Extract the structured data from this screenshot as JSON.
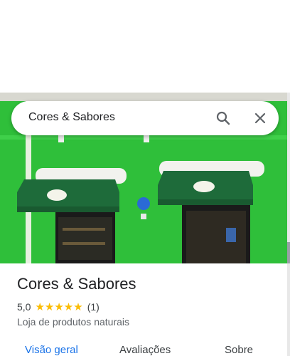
{
  "search": {
    "query": "Cores & Sabores",
    "search_icon": "search-icon",
    "close_icon": "close-icon"
  },
  "place": {
    "name": "Cores & Sabores",
    "rating": "5,0",
    "stars": "★★★★★",
    "review_count": "(1)",
    "category": "Loja de produtos naturais"
  },
  "tabs": [
    {
      "label": "Visão geral",
      "active": true
    },
    {
      "label": "Avaliações",
      "active": false
    },
    {
      "label": "Sobre",
      "active": false
    }
  ],
  "colors": {
    "accent": "#1a73e8",
    "star": "#fbbc04",
    "wall": "#2fbf3a",
    "awning": "#1e6b3a"
  }
}
